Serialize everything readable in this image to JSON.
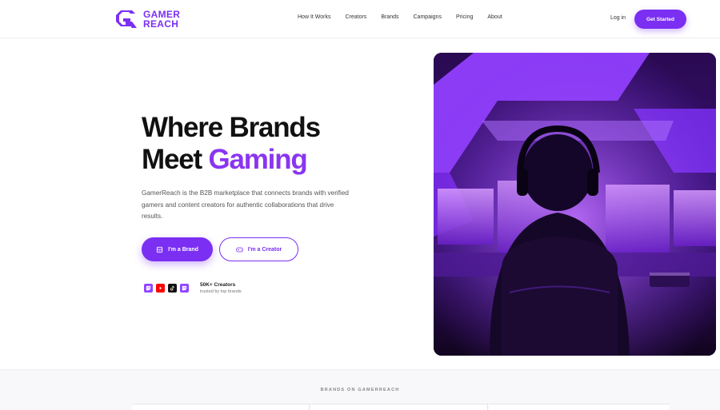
{
  "brand": {
    "line1": "GAMER",
    "line2": "REACH",
    "color": "#7b2ff2"
  },
  "nav": {
    "items": [
      "How It Works",
      "Creators",
      "Brands",
      "Campaigns",
      "Pricing",
      "About"
    ],
    "login": "Log in",
    "get_started": "Get Started"
  },
  "hero": {
    "headline_line1": "Where Brands",
    "headline_line2_plain": "Meet ",
    "headline_line2_accent": "Gaming",
    "description": "GamerReach is the B2B marketplace that connects brands with verified gamers and content creators for authentic collaborations that drive results.",
    "btn_brand": "I'm a Brand",
    "btn_creator": "I'm a Creator",
    "platforms": [
      {
        "name": "twitch-icon",
        "color": "#9146ff"
      },
      {
        "name": "youtube-icon",
        "color": "#ff0000"
      },
      {
        "name": "tiktok-icon",
        "color": "#111111"
      },
      {
        "name": "twitch-icon",
        "color": "#9146ff"
      }
    ],
    "stat_title": "50K+ Creators",
    "stat_sub": "trusted by top brands"
  },
  "brands_section": {
    "label": "BRANDS ON GAMERREACH"
  },
  "colors": {
    "accent": "#7b2ff2",
    "accent_light": "#8a35f0"
  }
}
